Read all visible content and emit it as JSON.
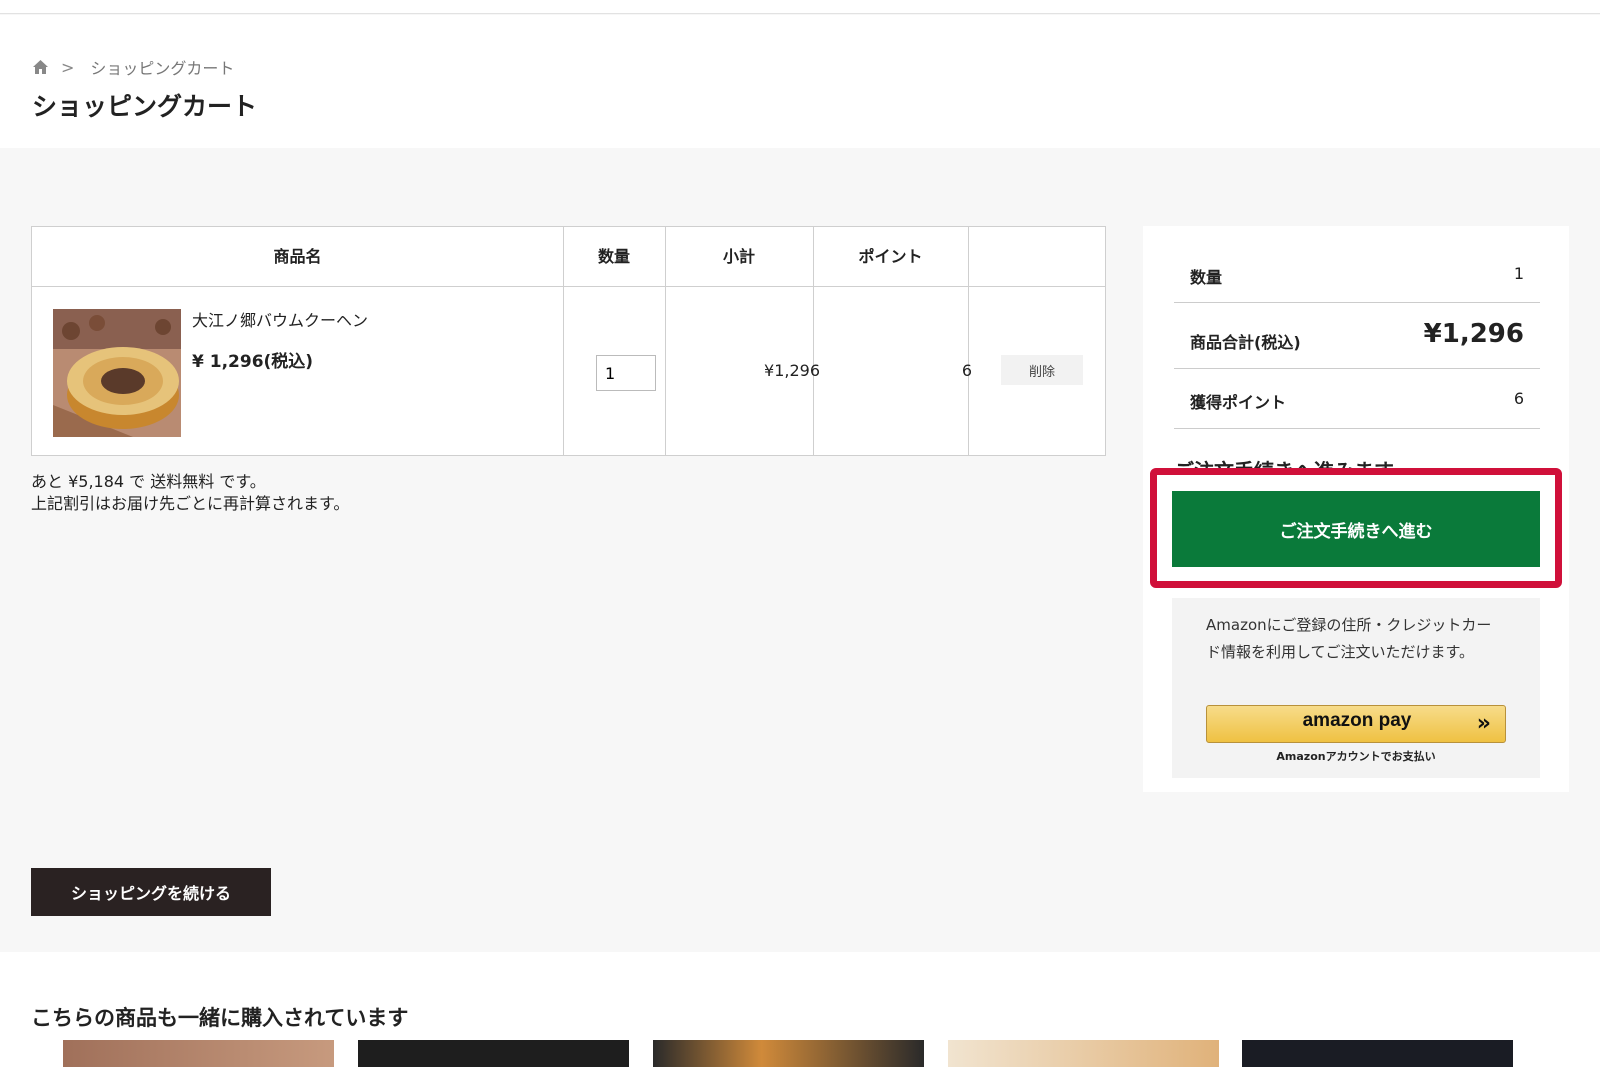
{
  "breadcrumb": {
    "current": "ショッピングカート",
    "separator": ">"
  },
  "page_title": "ショッピングカート",
  "table": {
    "headers": {
      "name": "商品名",
      "qty": "数量",
      "subtotal": "小計",
      "points": "ポイント"
    },
    "item": {
      "name": "大江ノ郷バウムクーヘン",
      "price": "¥ 1,296(税込)",
      "qty_value": "1",
      "subtotal": "¥1,296",
      "points": "6",
      "delete_label": "削除"
    }
  },
  "notes": {
    "shipping": "あと ¥5,184 で 送料無料 です。",
    "recalc": "上記割引はお届け先ごとに再計算されます。"
  },
  "summary": {
    "qty_label": "数量",
    "qty_value": "1",
    "total_label": "商品合計(税込)",
    "total_value": "¥1,296",
    "points_label": "獲得ポイント",
    "points_value": "6",
    "cutoff_text": "ご注文手続きへ進みます",
    "order_button": "ご注文手続きへ進む",
    "highlight_color": "#d0103a",
    "order_color": "#0a7a3a"
  },
  "amazon": {
    "text": "Amazonにご登録の住所・クレジットカード情報を利用してご注文いただけます。",
    "logo": "amazon pay",
    "chevron": "»",
    "caption": "Amazonアカウントでお支払い"
  },
  "continue_button": "ショッピングを続ける",
  "recommend_title": "こちらの商品も一緒に購入されています"
}
